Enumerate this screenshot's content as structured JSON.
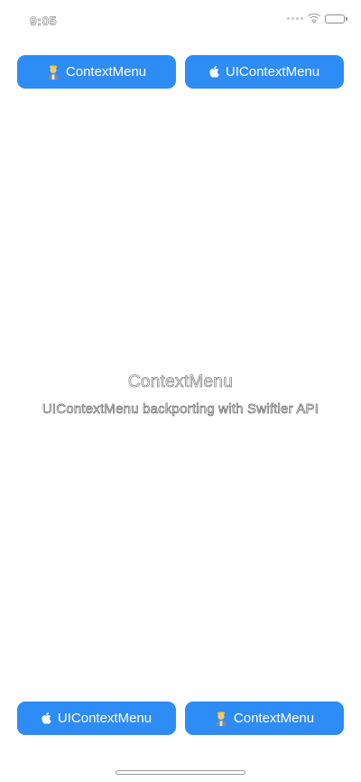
{
  "status_bar": {
    "time": "9:05"
  },
  "buttons": {
    "top_left": {
      "label": "ContextMenu",
      "icon": "person-emoji-icon"
    },
    "top_right": {
      "label": "UIContextMenu",
      "icon": "apple-icon"
    },
    "bottom_left": {
      "label": "UIContextMenu",
      "icon": "apple-icon"
    },
    "bottom_right": {
      "label": "ContextMenu",
      "icon": "person-emoji-icon"
    }
  },
  "center": {
    "title": "ContextMenu",
    "subtitle": "UIContextMenu backporting with Swiftier API"
  },
  "colors": {
    "button_background": "#2d8cf5",
    "button_text": "#ffffff",
    "background": "#ffffff"
  }
}
